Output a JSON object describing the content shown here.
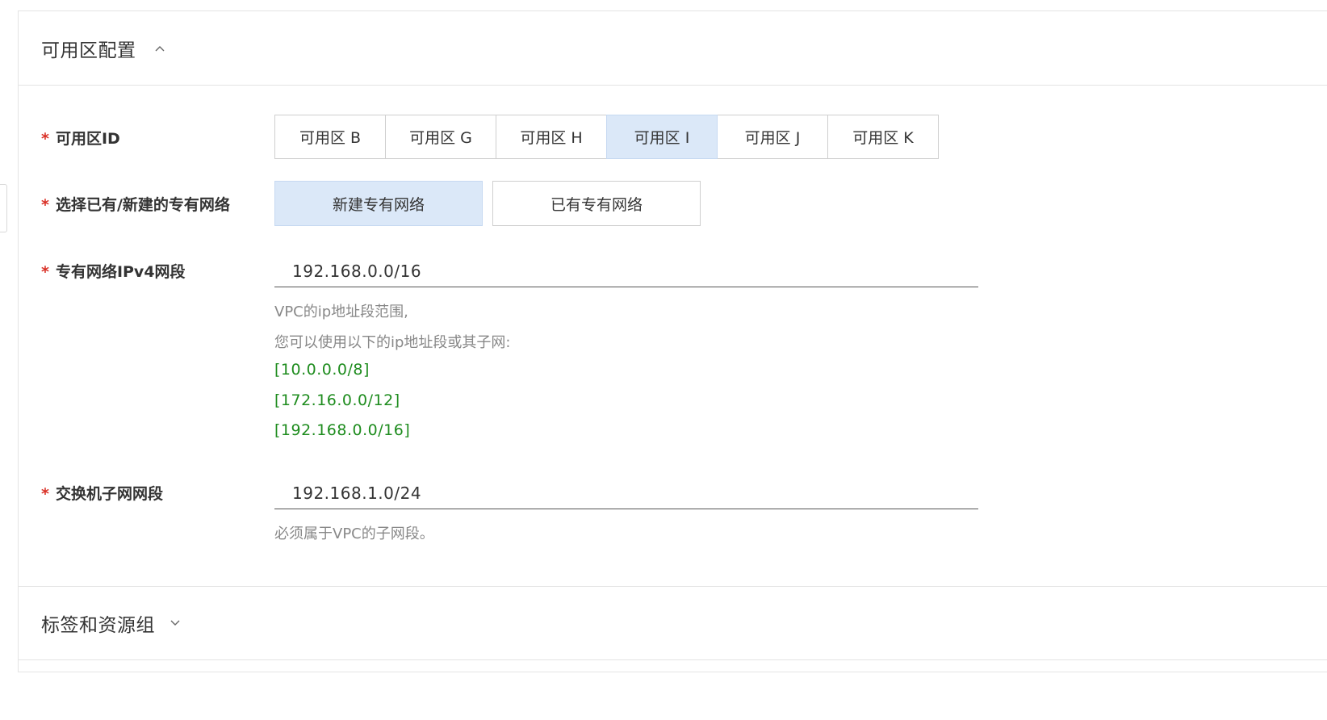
{
  "section_zone": {
    "title": "可用区配置",
    "expanded_icon": "chevron-up-icon"
  },
  "zone_id": {
    "label": "可用区ID",
    "required_mark": "*",
    "options": [
      "可用区 B",
      "可用区 G",
      "可用区 H",
      "可用区 I",
      "可用区 J",
      "可用区 K"
    ],
    "selected": "可用区 I"
  },
  "vpc_select": {
    "label": "选择已有/新建的专有网络",
    "required_mark": "*",
    "options": [
      "新建专有网络",
      "已有专有网络"
    ],
    "selected": "新建专有网络"
  },
  "vpc_cidr": {
    "label": "专有网络IPv4网段",
    "required_mark": "*",
    "value": "192.168.0.0/16",
    "hint_line1": "VPC的ip地址段范围,",
    "hint_line2": "您可以使用以下的ip地址段或其子网:",
    "suggestions": [
      "[10.0.0.0/8]",
      "[172.16.0.0/12]",
      "[192.168.0.0/16]"
    ],
    "suggestion_color": "#1e8c1e"
  },
  "vswitch_cidr": {
    "label": "交换机子网网段",
    "required_mark": "*",
    "value": "192.168.1.0/24",
    "hint": "必须属于VPC的子网段。"
  },
  "section_tags": {
    "title": "标签和资源组",
    "collapsed_icon": "chevron-down-icon"
  },
  "colors": {
    "selected_bg": "#dbe8f8",
    "required": "#d93026"
  }
}
